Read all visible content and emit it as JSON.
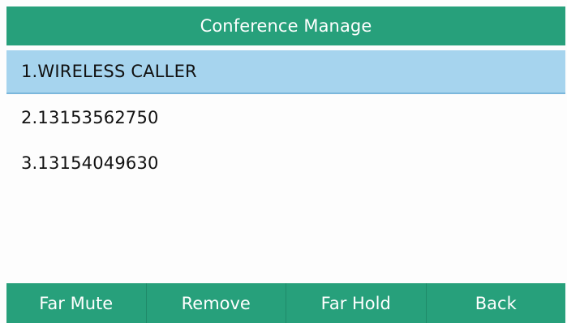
{
  "header": {
    "title": "Conference Manage"
  },
  "list": {
    "items": [
      {
        "label": "1.WIRELESS CALLER",
        "selected": true
      },
      {
        "label": "2.13153562750",
        "selected": false
      },
      {
        "label": "3.13154049630",
        "selected": false
      }
    ]
  },
  "softkeys": [
    {
      "label": "Far Mute"
    },
    {
      "label": "Remove"
    },
    {
      "label": "Far Hold"
    },
    {
      "label": "Back"
    }
  ],
  "colors": {
    "title_bar": "#27a07b",
    "softkey_bar": "#27a07b",
    "selected_row": "#a6d4ee"
  }
}
